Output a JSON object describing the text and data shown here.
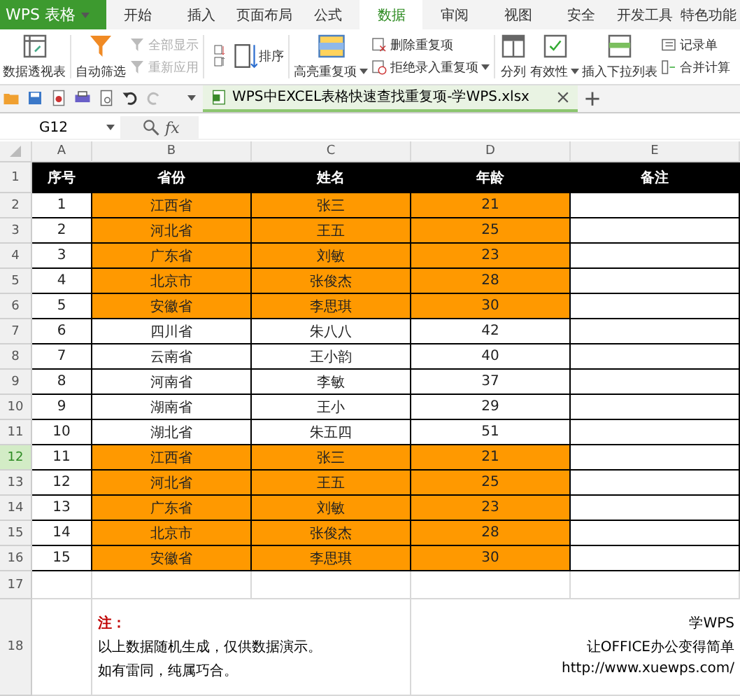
{
  "app_menu": {
    "label": "WPS 表格"
  },
  "tabs": [
    {
      "label": "开始",
      "selected": false
    },
    {
      "label": "插入",
      "selected": false
    },
    {
      "label": "页面布局",
      "selected": false
    },
    {
      "label": "公式",
      "selected": false
    },
    {
      "label": "数据",
      "selected": true
    },
    {
      "label": "审阅",
      "selected": false
    },
    {
      "label": "视图",
      "selected": false
    },
    {
      "label": "安全",
      "selected": false
    },
    {
      "label": "开发工具",
      "selected": false
    },
    {
      "label": "特色功能",
      "selected": false
    }
  ],
  "ribbon": [
    {
      "kind": "large",
      "items": [
        {
          "label": "数据透视表",
          "disabled": false,
          "dropdown": false
        }
      ]
    },
    {
      "kind": "large",
      "items": [
        {
          "label": "自动筛选",
          "disabled": false,
          "dropdown": false
        }
      ]
    },
    {
      "kind": "stack",
      "items": [
        {
          "label": "全部显示",
          "disabled": true,
          "dropdown": false
        },
        {
          "label": "重新应用",
          "disabled": true,
          "dropdown": false
        }
      ]
    },
    {
      "kind": "sort",
      "items": [
        {
          "label": "排序",
          "disabled": false,
          "dropdown": false
        }
      ]
    },
    {
      "kind": "large",
      "items": [
        {
          "label": "高亮重复项",
          "disabled": false,
          "dropdown": true
        }
      ]
    },
    {
      "kind": "stack",
      "items": [
        {
          "label": "删除重复项",
          "disabled": false,
          "dropdown": false
        },
        {
          "label": "拒绝录入重复项",
          "disabled": false,
          "dropdown": true
        }
      ]
    },
    {
      "kind": "large",
      "items": [
        {
          "label": "分列",
          "disabled": false,
          "dropdown": false
        }
      ]
    },
    {
      "kind": "large",
      "items": [
        {
          "label": "有效性",
          "disabled": false,
          "dropdown": true
        }
      ]
    },
    {
      "kind": "large",
      "items": [
        {
          "label": "插入下拉列表",
          "disabled": false,
          "dropdown": false
        }
      ]
    },
    {
      "kind": "stack",
      "items": [
        {
          "label": "记录单",
          "disabled": false,
          "dropdown": false
        },
        {
          "label": "合并计算",
          "disabled": false,
          "dropdown": false
        }
      ]
    }
  ],
  "document_tab": {
    "title": "WPS中EXCEL表格快速查找重复项-学WPS.xlsx",
    "selected": true
  },
  "formula_bar": {
    "cell_ref": "G12",
    "fx": "fx"
  },
  "sheet": {
    "columns": [
      "A",
      "B",
      "C",
      "D",
      "E"
    ],
    "rows": [
      {
        "kind": "header",
        "number": "1",
        "selected": false,
        "cells": [
          "序号",
          "省份",
          "姓名",
          "年龄",
          "备注"
        ]
      },
      {
        "kind": "data",
        "number": "2",
        "selected": false,
        "highlighted": true,
        "cells": [
          "1",
          "江西省",
          "张三",
          "21"
        ]
      },
      {
        "kind": "data",
        "number": "3",
        "selected": false,
        "highlighted": true,
        "cells": [
          "2",
          "河北省",
          "王五",
          "25"
        ]
      },
      {
        "kind": "data",
        "number": "4",
        "selected": false,
        "highlighted": true,
        "cells": [
          "3",
          "广东省",
          "刘敏",
          "23"
        ]
      },
      {
        "kind": "data",
        "number": "5",
        "selected": false,
        "highlighted": true,
        "cells": [
          "4",
          "北京市",
          "张俊杰",
          "28"
        ]
      },
      {
        "kind": "data",
        "number": "6",
        "selected": false,
        "highlighted": true,
        "cells": [
          "5",
          "安徽省",
          "李思琪",
          "30"
        ]
      },
      {
        "kind": "data",
        "number": "7",
        "selected": false,
        "highlighted": false,
        "cells": [
          "6",
          "四川省",
          "朱八八",
          "42"
        ]
      },
      {
        "kind": "data",
        "number": "8",
        "selected": false,
        "highlighted": false,
        "cells": [
          "7",
          "云南省",
          "王小韵",
          "40"
        ]
      },
      {
        "kind": "data",
        "number": "9",
        "selected": false,
        "highlighted": false,
        "cells": [
          "8",
          "河南省",
          "李敏",
          "37"
        ]
      },
      {
        "kind": "data",
        "number": "10",
        "selected": false,
        "highlighted": false,
        "cells": [
          "9",
          "湖南省",
          "王小",
          "29"
        ]
      },
      {
        "kind": "data",
        "number": "11",
        "selected": false,
        "highlighted": false,
        "cells": [
          "10",
          "湖北省",
          "朱五四",
          "51"
        ]
      },
      {
        "kind": "data",
        "number": "12",
        "selected": true,
        "highlighted": true,
        "cells": [
          "11",
          "江西省",
          "张三",
          "21"
        ]
      },
      {
        "kind": "data",
        "number": "13",
        "selected": false,
        "highlighted": true,
        "cells": [
          "12",
          "河北省",
          "王五",
          "25"
        ]
      },
      {
        "kind": "data",
        "number": "14",
        "selected": false,
        "highlighted": true,
        "cells": [
          "13",
          "广东省",
          "刘敏",
          "23"
        ]
      },
      {
        "kind": "data",
        "number": "15",
        "selected": false,
        "highlighted": true,
        "cells": [
          "14",
          "北京市",
          "张俊杰",
          "28"
        ]
      },
      {
        "kind": "data",
        "number": "16",
        "selected": false,
        "highlighted": true,
        "cells": [
          "15",
          "安徽省",
          "李思琪",
          "30"
        ]
      },
      {
        "kind": "empty",
        "number": "17",
        "selected": false
      },
      {
        "kind": "note",
        "number": "18",
        "selected": false,
        "note_title": "注：",
        "note_lines": [
          "以上数据随机生成，仅供数据演示。",
          "如有雷同，纯属巧合。"
        ],
        "credit_lines": [
          "学WPS",
          "让OFFICE办公变得简单",
          "http://www.xuewps.com/"
        ]
      }
    ]
  }
}
